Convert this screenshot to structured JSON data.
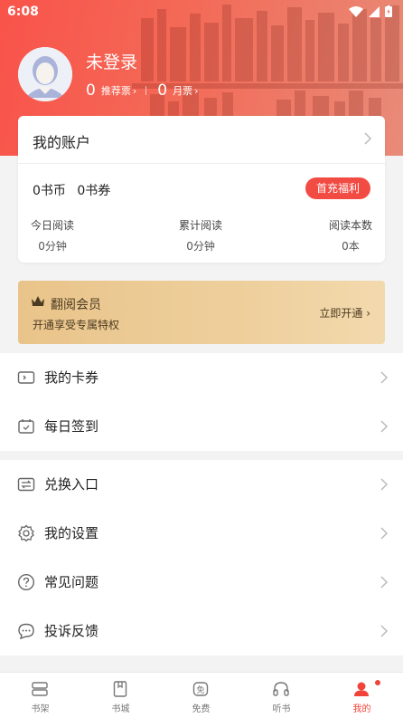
{
  "status": {
    "time": "6:08"
  },
  "profile": {
    "username": "未登录",
    "recommend_count": "0",
    "recommend_label": "推荐票",
    "monthly_count": "0",
    "monthly_label": "月票"
  },
  "account": {
    "title": "我的账户",
    "coins": "0书币",
    "vouchers": "0书券",
    "bonus_button": "首充福利",
    "stats": [
      {
        "label": "今日阅读",
        "value": "0分钟"
      },
      {
        "label": "累计阅读",
        "value": "0分钟"
      },
      {
        "label": "阅读本数",
        "value": "0本"
      }
    ]
  },
  "vip": {
    "title": "翻阅会员",
    "subtitle": "开通享受专属特权",
    "action": "立即开通 ›"
  },
  "menu": {
    "group1": [
      {
        "label": "我的卡券",
        "icon": "card-coupon-icon"
      },
      {
        "label": "每日签到",
        "icon": "calendar-checkin-icon"
      }
    ],
    "group2": [
      {
        "label": "兑换入口",
        "icon": "exchange-icon"
      },
      {
        "label": "我的设置",
        "icon": "gear-icon"
      },
      {
        "label": "常见问题",
        "icon": "question-icon"
      },
      {
        "label": "投诉反馈",
        "icon": "chat-feedback-icon"
      }
    ]
  },
  "nav": {
    "tabs": [
      {
        "label": "书架",
        "icon": "bookshelf-icon"
      },
      {
        "label": "书城",
        "icon": "bookstore-icon"
      },
      {
        "label": "免费",
        "icon": "free-icon"
      },
      {
        "label": "听书",
        "icon": "headphones-icon"
      },
      {
        "label": "我的",
        "icon": "profile-icon",
        "active": true
      }
    ]
  },
  "colors": {
    "accent": "#f24b44",
    "vip_gold": "#e9c48a"
  }
}
